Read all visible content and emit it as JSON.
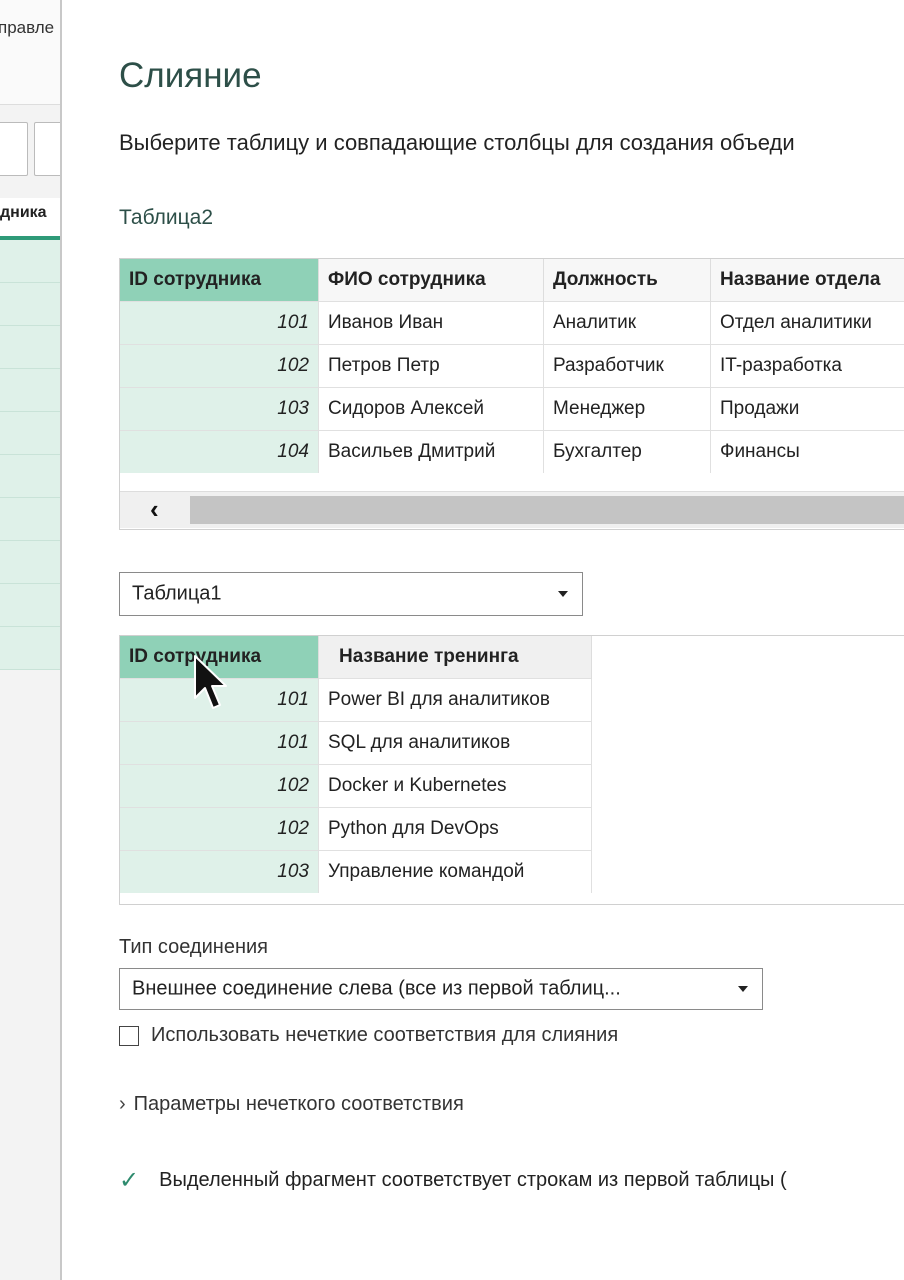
{
  "background_app": {
    "ribbon_text": "правле",
    "column_header": "дника"
  },
  "dialog": {
    "title": "Слияние",
    "subtitle": "Выберите таблицу и совпадающие столбцы для создания объеди",
    "table2_name": "Таблица2",
    "table2": {
      "columns": [
        "ID сотрудника",
        "ФИО сотрудника",
        "Должность",
        "Название отдела"
      ],
      "rows": [
        [
          "101",
          "Иванов Иван",
          "Аналитик",
          "Отдел аналитики"
        ],
        [
          "102",
          "Петров Петр",
          "Разработчик",
          "IT-разработка"
        ],
        [
          "103",
          "Сидоров Алексей",
          "Менеджер",
          "Продажи"
        ],
        [
          "104",
          "Васильев Дмитрий",
          "Бухгалтер",
          "Финансы"
        ]
      ]
    },
    "table_select": {
      "value": "Таблица1"
    },
    "table1": {
      "columns": [
        "ID сотрудника",
        "Название тренинга"
      ],
      "rows": [
        [
          "101",
          "Power BI для аналитиков"
        ],
        [
          "101",
          "SQL для аналитиков"
        ],
        [
          "102",
          "Docker и Kubernetes"
        ],
        [
          "102",
          "Python для DevOps"
        ],
        [
          "103",
          "Управление командой"
        ]
      ]
    },
    "join_type_label": "Тип соединения",
    "join_type_value": "Внешнее соединение слева (все из первой таблиц...",
    "fuzzy_checkbox_label": "Использовать нечеткие соответствия для слияния",
    "fuzzy_params_label": "Параметры нечеткого соответствия",
    "status_text": "Выделенный фрагмент соответствует строкам из первой таблицы ("
  },
  "colors": {
    "accent": "#2e9a78",
    "selected_header": "#8fd1b7",
    "selected_cell": "#dff1e9"
  }
}
